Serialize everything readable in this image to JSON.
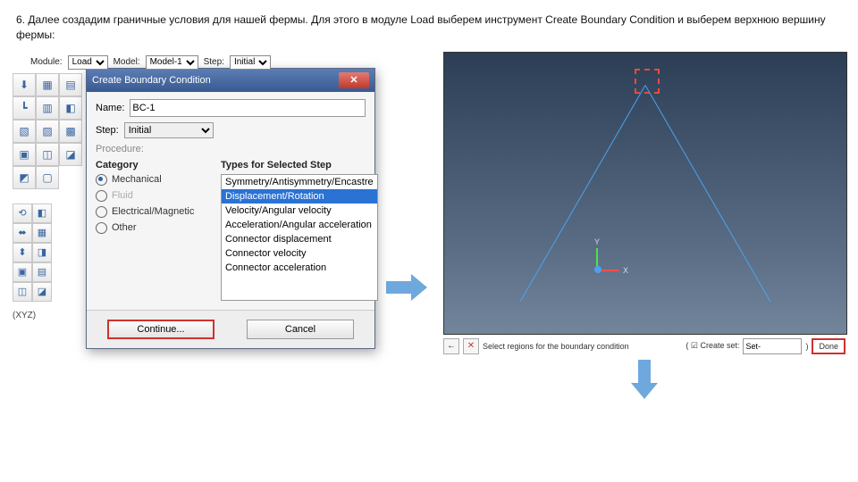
{
  "instruction": "6. Далее создадим граничные условия для нашей фермы. Для этого в модуле Load выберем инструмент Create Boundary Condition и выберем верхнюю вершину фермы:",
  "context_bar": {
    "module_label": "Module:",
    "module_value": "Load",
    "model_label": "Model:",
    "model_value": "Model-1",
    "step_label": "Step:",
    "step_value": "Initial"
  },
  "dialog": {
    "title": "Create Boundary Condition",
    "name_label": "Name:",
    "name_value": "BC-1",
    "step_label": "Step:",
    "step_value": "Initial",
    "procedure_label": "Procedure:",
    "category_header": "Category",
    "categories": [
      {
        "label": "Mechanical",
        "checked": true,
        "disabled": false
      },
      {
        "label": "Fluid",
        "checked": false,
        "disabled": true
      },
      {
        "label": "Electrical/Magnetic",
        "checked": false,
        "disabled": false
      },
      {
        "label": "Other",
        "checked": false,
        "disabled": false
      }
    ],
    "types_header": "Types for Selected Step",
    "types": [
      "Symmetry/Antisymmetry/Encastre",
      "Displacement/Rotation",
      "Velocity/Angular velocity",
      "Acceleration/Angular acceleration",
      "Connector displacement",
      "Connector velocity",
      "Connector acceleration"
    ],
    "selected_type_index": 1,
    "continue_label": "Continue...",
    "cancel_label": "Cancel"
  },
  "xyz_label": "(XYZ)",
  "prompt_bar": {
    "back": "←",
    "cancel": "✕",
    "text": "Select regions for the boundary condition",
    "create_set_label": "Create set:",
    "set_field": "Set-",
    "done_label": "Done"
  },
  "axis": {
    "y": "Y",
    "x": "X"
  }
}
